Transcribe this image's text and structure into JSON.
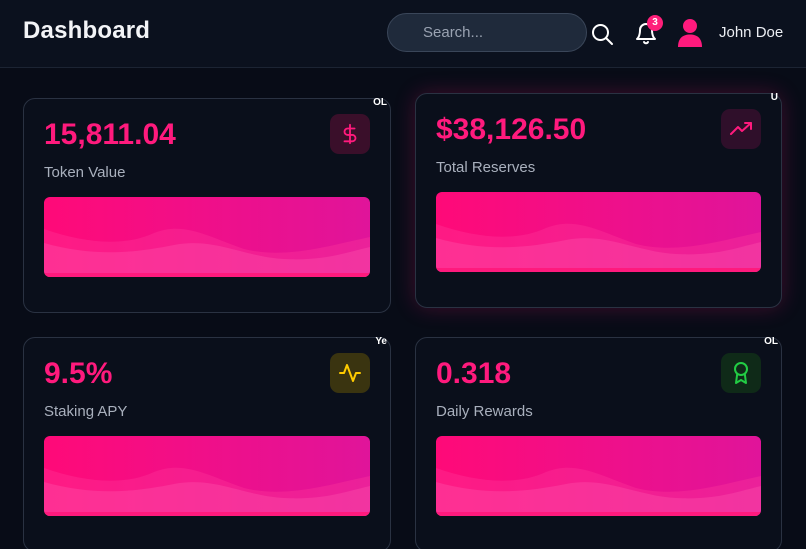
{
  "header": {
    "title": "Dashboard",
    "search_placeholder": "Search...",
    "notification_count": "3",
    "user_name": "John Doe"
  },
  "cards": [
    {
      "value": "15,811.04",
      "label": "Token Value",
      "icon": "dollar-icon",
      "icon_color": "#ff1a7d",
      "icon_bg": "#3a0f2a",
      "tag": "OL"
    },
    {
      "value": "$38,126.50",
      "label": "Total Reserves",
      "icon": "trending-up-icon",
      "icon_color": "#ff1a7d",
      "icon_bg": "#2f0f2a",
      "tag": "U"
    },
    {
      "value": "9.5%",
      "label": "Staking APY",
      "icon": "activity-icon",
      "icon_color": "#ffcc00",
      "icon_bg": "#3a3410",
      "tag": "Ye"
    },
    {
      "value": "0.318",
      "label": "Daily Rewards",
      "icon": "award-icon",
      "icon_color": "#22cc44",
      "icon_bg": "#0f2a18",
      "tag": "OL"
    }
  ],
  "colors": {
    "accent": "#ff1a7d",
    "background": "#080c17",
    "card_border": "#2a3242"
  }
}
